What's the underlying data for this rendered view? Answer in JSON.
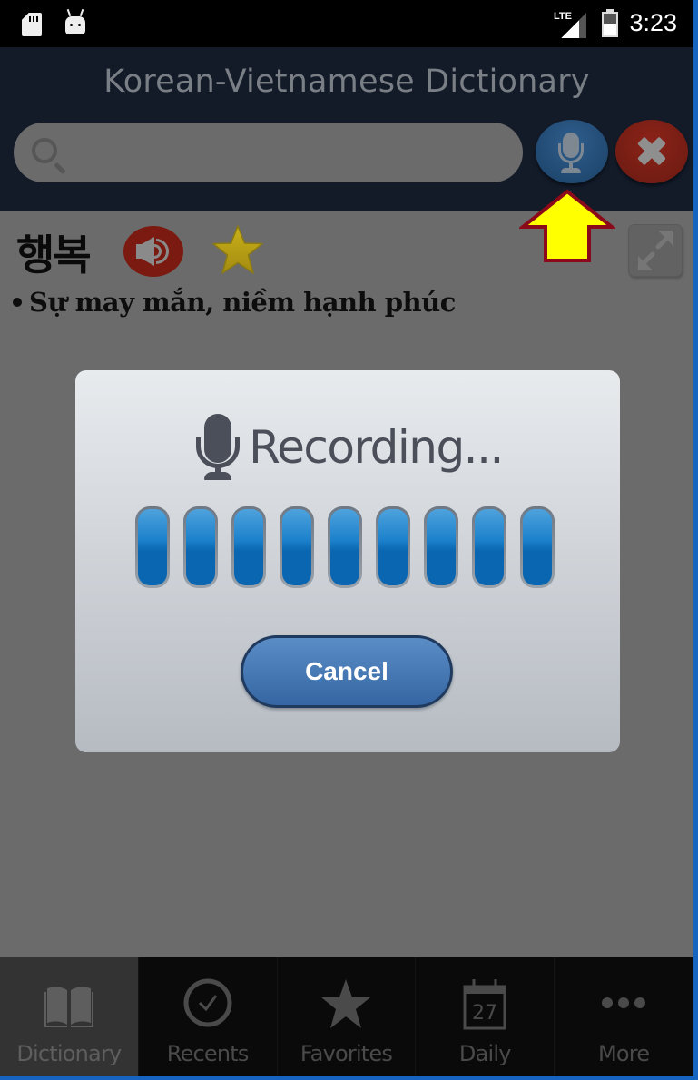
{
  "status_bar": {
    "network": "LTE",
    "time": "3:23",
    "icons": [
      "sd-card-icon",
      "android-debug-icon",
      "lte-signal-icon",
      "battery-charging-icon"
    ]
  },
  "header": {
    "title": "Korean-Vietnamese Dictionary",
    "search": {
      "value": "",
      "placeholder": ""
    },
    "icons": {
      "search": "search-icon",
      "mic": "microphone-icon",
      "close": "close-icon"
    }
  },
  "entry": {
    "word": "행복",
    "meaning": "Sự may mắn, niềm hạnh phúc",
    "icons": {
      "speak": "speaker-icon",
      "favorite": "star-icon",
      "expand": "expand-icon"
    }
  },
  "annotation": {
    "arrow": "up-arrow-icon"
  },
  "dialog": {
    "title": "Recording...",
    "level_count": 9,
    "cancel_label": "Cancel"
  },
  "tabs": [
    {
      "label": "Dictionary",
      "icon": "book-icon",
      "active": true
    },
    {
      "label": "Recents",
      "icon": "clock-check-icon",
      "active": false
    },
    {
      "label": "Favorites",
      "icon": "star-icon",
      "active": false
    },
    {
      "label": "Daily",
      "icon": "calendar-icon",
      "active": false,
      "badge": "27"
    },
    {
      "label": "More",
      "icon": "more-icon",
      "active": false
    }
  ],
  "colors": {
    "header_bg": "#131b29",
    "content_bg": "#6b6b6b",
    "level_blue": "#0a66b0",
    "cancel_blue": "#4778b4",
    "arrow_fill": "#ffff00",
    "arrow_stroke": "#8b0a1a"
  }
}
